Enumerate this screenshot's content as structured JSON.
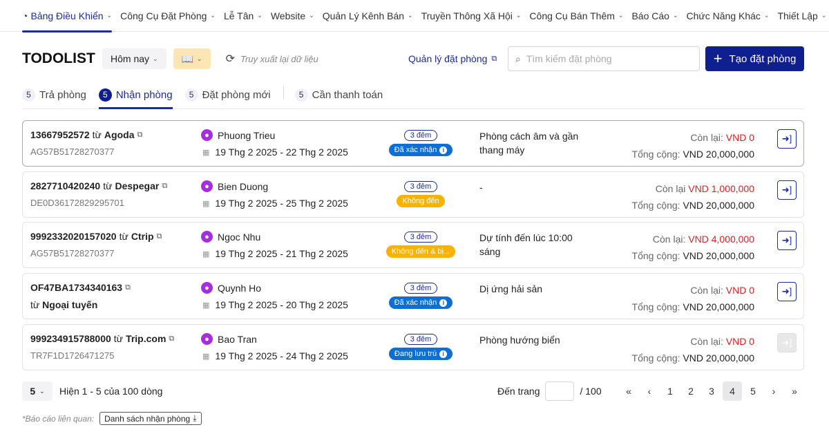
{
  "nav": [
    {
      "label": "Bảng Điều Khiển",
      "active": true
    },
    {
      "label": "Công Cụ Đặt Phòng"
    },
    {
      "label": "Lễ Tân"
    },
    {
      "label": "Website"
    },
    {
      "label": "Quản Lý Kênh Bán"
    },
    {
      "label": "Truyền Thông Xã Hội"
    },
    {
      "label": "Công Cụ Bán Thêm"
    },
    {
      "label": "Báo Cáo"
    },
    {
      "label": "Chức Năng Khác"
    },
    {
      "label": "Thiết Lập"
    }
  ],
  "toolbar": {
    "title": "TODOLIST",
    "date_filter": "Hôm nay",
    "refresh": "Truy xuất lại dữ liệu",
    "manage_link": "Quản lý đặt phòng",
    "search_placeholder": "Tìm kiếm đặt phòng",
    "create_label": "Tạo đặt phòng"
  },
  "tabs": [
    {
      "count": "5",
      "label": "Trả phòng"
    },
    {
      "count": "5",
      "label": "Nhận phòng",
      "active": true
    },
    {
      "count": "5",
      "label": "Đặt phòng mới"
    },
    {
      "count": "5",
      "label": "Cần thanh toán"
    }
  ],
  "bookings": [
    {
      "id": "13667952572",
      "from": "từ",
      "source": "Agoda",
      "ref": "AG57B51728270377",
      "guest": "Phuong Trieu",
      "dates": "19 Thg 2 2025 - 22 Thg 2 2025",
      "nights": "3 đêm",
      "status": "Đã xác nhận",
      "status_color": "#0d6fd4",
      "note": "Phòng cách âm và gần thang máy",
      "remaining_label": "Còn lại:",
      "remaining": "VND 0",
      "total_label": "Tổng cộng:",
      "total": "VND 20,000,000"
    },
    {
      "id": "2827710420240",
      "from": "từ",
      "source": "Despegar",
      "ref": "DE0D36172829295701",
      "guest": "Bien Duong",
      "dates": "19 Thg 2 2025 - 25 Thg 2 2025",
      "nights": "3 đêm",
      "status": "Không đến",
      "status_color": "#f9b200",
      "note": "-",
      "remaining_label": "Còn lại",
      "remaining": "VND 1,000,000",
      "total_label": "Tổng cộng:",
      "total": "VND 20,000,000"
    },
    {
      "id": "9992332020157020",
      "from": "từ",
      "source": "Ctrip",
      "ref": "AG57B51728270377",
      "guest": "Ngoc Nhu",
      "dates": "19 Thg 2 2025 - 21 Thg 2 2025",
      "nights": "3 đêm",
      "status": "Không đến & bị...",
      "status_color": "#f9b200",
      "note": "Dự tính đến lúc 10:00 sáng",
      "remaining_label": "Còn lại:",
      "remaining": "VND 4,000,000",
      "total_label": "Tổng cộng:",
      "total": "VND 20,000,000"
    },
    {
      "id": "OF47BA1734340163",
      "from": "từ",
      "source": "Ngoại tuyến",
      "ref": "",
      "guest": "Quynh Ho",
      "dates": "19 Thg 2 2025 - 20 Thg 2 2025",
      "nights": "3 đêm",
      "status": "Đã xác nhận",
      "status_color": "#0d6fd4",
      "note": "Dị ứng hải sản",
      "remaining_label": "Còn lại:",
      "remaining": "VND 0",
      "total_label": "Tổng cộng:",
      "total": "VND 20,000,000"
    },
    {
      "id": "999234915788000",
      "from": "từ",
      "source": "Trip.com",
      "ref": "TR7F1D1726471275",
      "guest": "Bao Tran",
      "dates": "19 Thg 2 2025 - 24 Thg 2 2025",
      "nights": "3 đêm",
      "status": "Đang lưu trú",
      "status_color": "#0d6fd4",
      "note": "Phòng hướng biển",
      "remaining_label": "Còn lại:",
      "remaining": "VND 0",
      "total_label": "Tổng cộng:",
      "total": "VND 20,000,000",
      "disabled": true
    }
  ],
  "footer": {
    "page_size": "5",
    "summary": "Hiện 1 - 5 của 100 dòng",
    "goto_label": "Đến trang",
    "goto_value": "",
    "total_pages": "/ 100",
    "pages": [
      "1",
      "2",
      "3",
      "4",
      "5"
    ],
    "current_page": "4",
    "report_label": "*Báo cáo liên quan:",
    "report_button": "Danh sách nhận phòng"
  }
}
